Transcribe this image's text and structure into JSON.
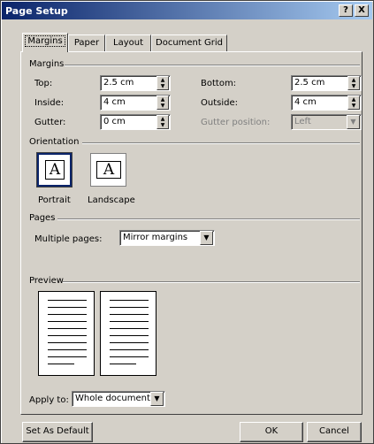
{
  "window": {
    "title": "Page Setup",
    "help_btn": "?",
    "close_btn": "X"
  },
  "tabs": [
    {
      "label": "Margins",
      "active": true
    },
    {
      "label": "Paper",
      "active": false
    },
    {
      "label": "Layout",
      "active": false
    },
    {
      "label": "Document Grid",
      "active": false
    }
  ],
  "margins": {
    "group_label": "Margins",
    "top": {
      "label": "Top:",
      "value": "2.5 cm"
    },
    "bottom": {
      "label": "Bottom:",
      "value": "2.5 cm"
    },
    "inside": {
      "label": "Inside:",
      "value": "4 cm"
    },
    "outside": {
      "label": "Outside:",
      "value": "4 cm"
    },
    "gutter": {
      "label": "Gutter:",
      "value": "0 cm"
    },
    "gutter_position": {
      "label": "Gutter position:",
      "value": "Left"
    }
  },
  "orientation": {
    "group_label": "Orientation",
    "portrait": "Portrait",
    "landscape": "Landscape",
    "glyph": "A"
  },
  "pages": {
    "group_label": "Pages",
    "multiple_label": "Multiple pages:",
    "multiple_value": "Mirror margins"
  },
  "preview": {
    "group_label": "Preview"
  },
  "apply": {
    "label": "Apply to:",
    "value": "Whole document"
  },
  "footer": {
    "default_btn": "Set As Default",
    "ok_btn": "OK",
    "cancel_btn": "Cancel"
  },
  "colors": {
    "dialog_bg": "#d4d0c8",
    "titlebar_start": "#0a246a",
    "titlebar_end": "#a6caf0"
  },
  "icons": {
    "spin_up": "spin-up-icon",
    "spin_down": "spin-down-icon",
    "dropdown": "chevron-down-icon"
  }
}
